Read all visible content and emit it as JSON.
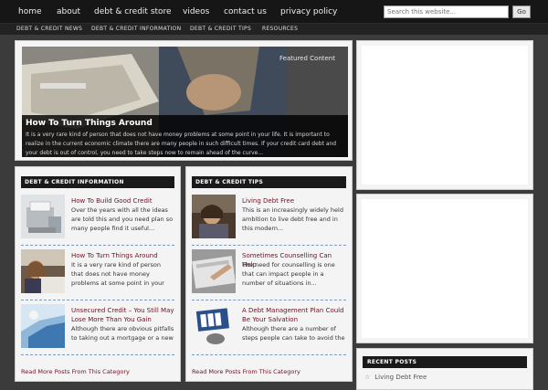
{
  "nav": {
    "items": [
      "home",
      "about",
      "debt & credit store",
      "videos",
      "contact us",
      "privacy policy"
    ],
    "search_placeholder": "Search this website...",
    "search_button": "Go"
  },
  "subnav": {
    "items": [
      "DEBT & CREDIT NEWS",
      "DEBT & CREDIT INFORMATION",
      "DEBT & CREDIT TIPS",
      "RESOURCES"
    ]
  },
  "featured": {
    "tag": "Featured Content",
    "title": "How To Turn Things Around",
    "excerpt": "It is a very rare kind of person that does not have money problems at some point in your life. It is important to realize in the current economic climate there are many people in such difficult times. If your credit card debt and your debt is out of control, you need to take steps now to remain ahead of the curve..."
  },
  "left_category": {
    "header": "DEBT & CREDIT INFORMATION",
    "posts": [
      {
        "title": "How To Build Good Credit",
        "excerpt": "Over the years with all the ideas are told this and you need plan so many people find it useful..."
      },
      {
        "title": "How To Turn Things Around",
        "excerpt": "It is a very rare kind of person that does not have money problems at some point in your life..."
      },
      {
        "title": "Unsecured Credit – You Still May Lose More Than You Gain",
        "excerpt": "Although there are obvious pitfalls to taking out a mortgage or a new car loan which..."
      }
    ],
    "read_more": "Read More Posts From This Category"
  },
  "right_category": {
    "header": "DEBT & CREDIT TIPS",
    "posts": [
      {
        "title": "Living Debt Free",
        "excerpt": "This is an increasingly widely held ambition to live debt free and in this modern..."
      },
      {
        "title": "Sometimes Counselling Can Help",
        "excerpt": "The need for counselling is one that can impact people in a number of situations in..."
      },
      {
        "title": "A Debt Management Plan Could Be Your Salvation",
        "excerpt": "Although there are a number of steps people can take to avoid the potential pitfalls of irresponsible..."
      }
    ],
    "read_more": "Read More Posts From This Category"
  },
  "sidebar": {
    "recent_header": "RECENT POSTS",
    "recent_items": [
      "Living Debt Free"
    ]
  }
}
